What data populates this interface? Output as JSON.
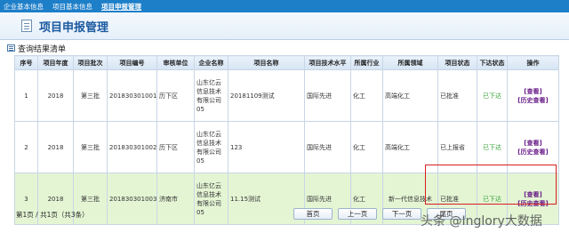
{
  "topnav": {
    "items": [
      "企业基本信息",
      "项目基本信息",
      "项目申报管理"
    ]
  },
  "header": {
    "title": "项目申报管理"
  },
  "section": {
    "title": "查询结果清单"
  },
  "table": {
    "columns": [
      "序号",
      "项目年度",
      "项目批次",
      "项目编号",
      "审核单位",
      "企业名称",
      "项目名称",
      "项目技术水平",
      "所属行业",
      "所属领域",
      "项目状态",
      "下达状态",
      "操作"
    ],
    "rows": [
      {
        "no": "1",
        "year": "2018",
        "batch": "第三批",
        "code": "201830301001",
        "auditor": "历下区",
        "company": "山东亿云信息技术有限公司05",
        "name": "20181109测试",
        "tech": "国际先进",
        "industry": "化工",
        "field": "高端化工",
        "status": "已批准",
        "issue": "已下达",
        "view": "[查看]",
        "history": "[历史查看]"
      },
      {
        "no": "2",
        "year": "2018",
        "batch": "第三批",
        "code": "201830301002",
        "auditor": "历下区",
        "company": "山东亿云信息技术有限公司05",
        "name": "123",
        "tech": "国际先进",
        "industry": "化工",
        "field": "高端化工",
        "status": "已上报省",
        "issue": "已下达",
        "view": "[查看]",
        "history": "[历史查看]"
      },
      {
        "no": "3",
        "year": "2018",
        "batch": "第三批",
        "code": "201830301003",
        "auditor": "济南市",
        "company": "山东亿云信息技术有限公司05",
        "name": "11.15测试",
        "tech": "国际先进",
        "industry": "化工",
        "field": "新一代信息技术",
        "status": "已批准",
        "issue": "已下达",
        "view": "[查看]",
        "history": "[历史查看]"
      }
    ]
  },
  "pager": {
    "info": "第1页 / 共1页（共3条）",
    "first": "首页",
    "prev": "上一页",
    "next": "下一页",
    "last": "尾页"
  },
  "watermark": "头条 @Inglory大数据"
}
